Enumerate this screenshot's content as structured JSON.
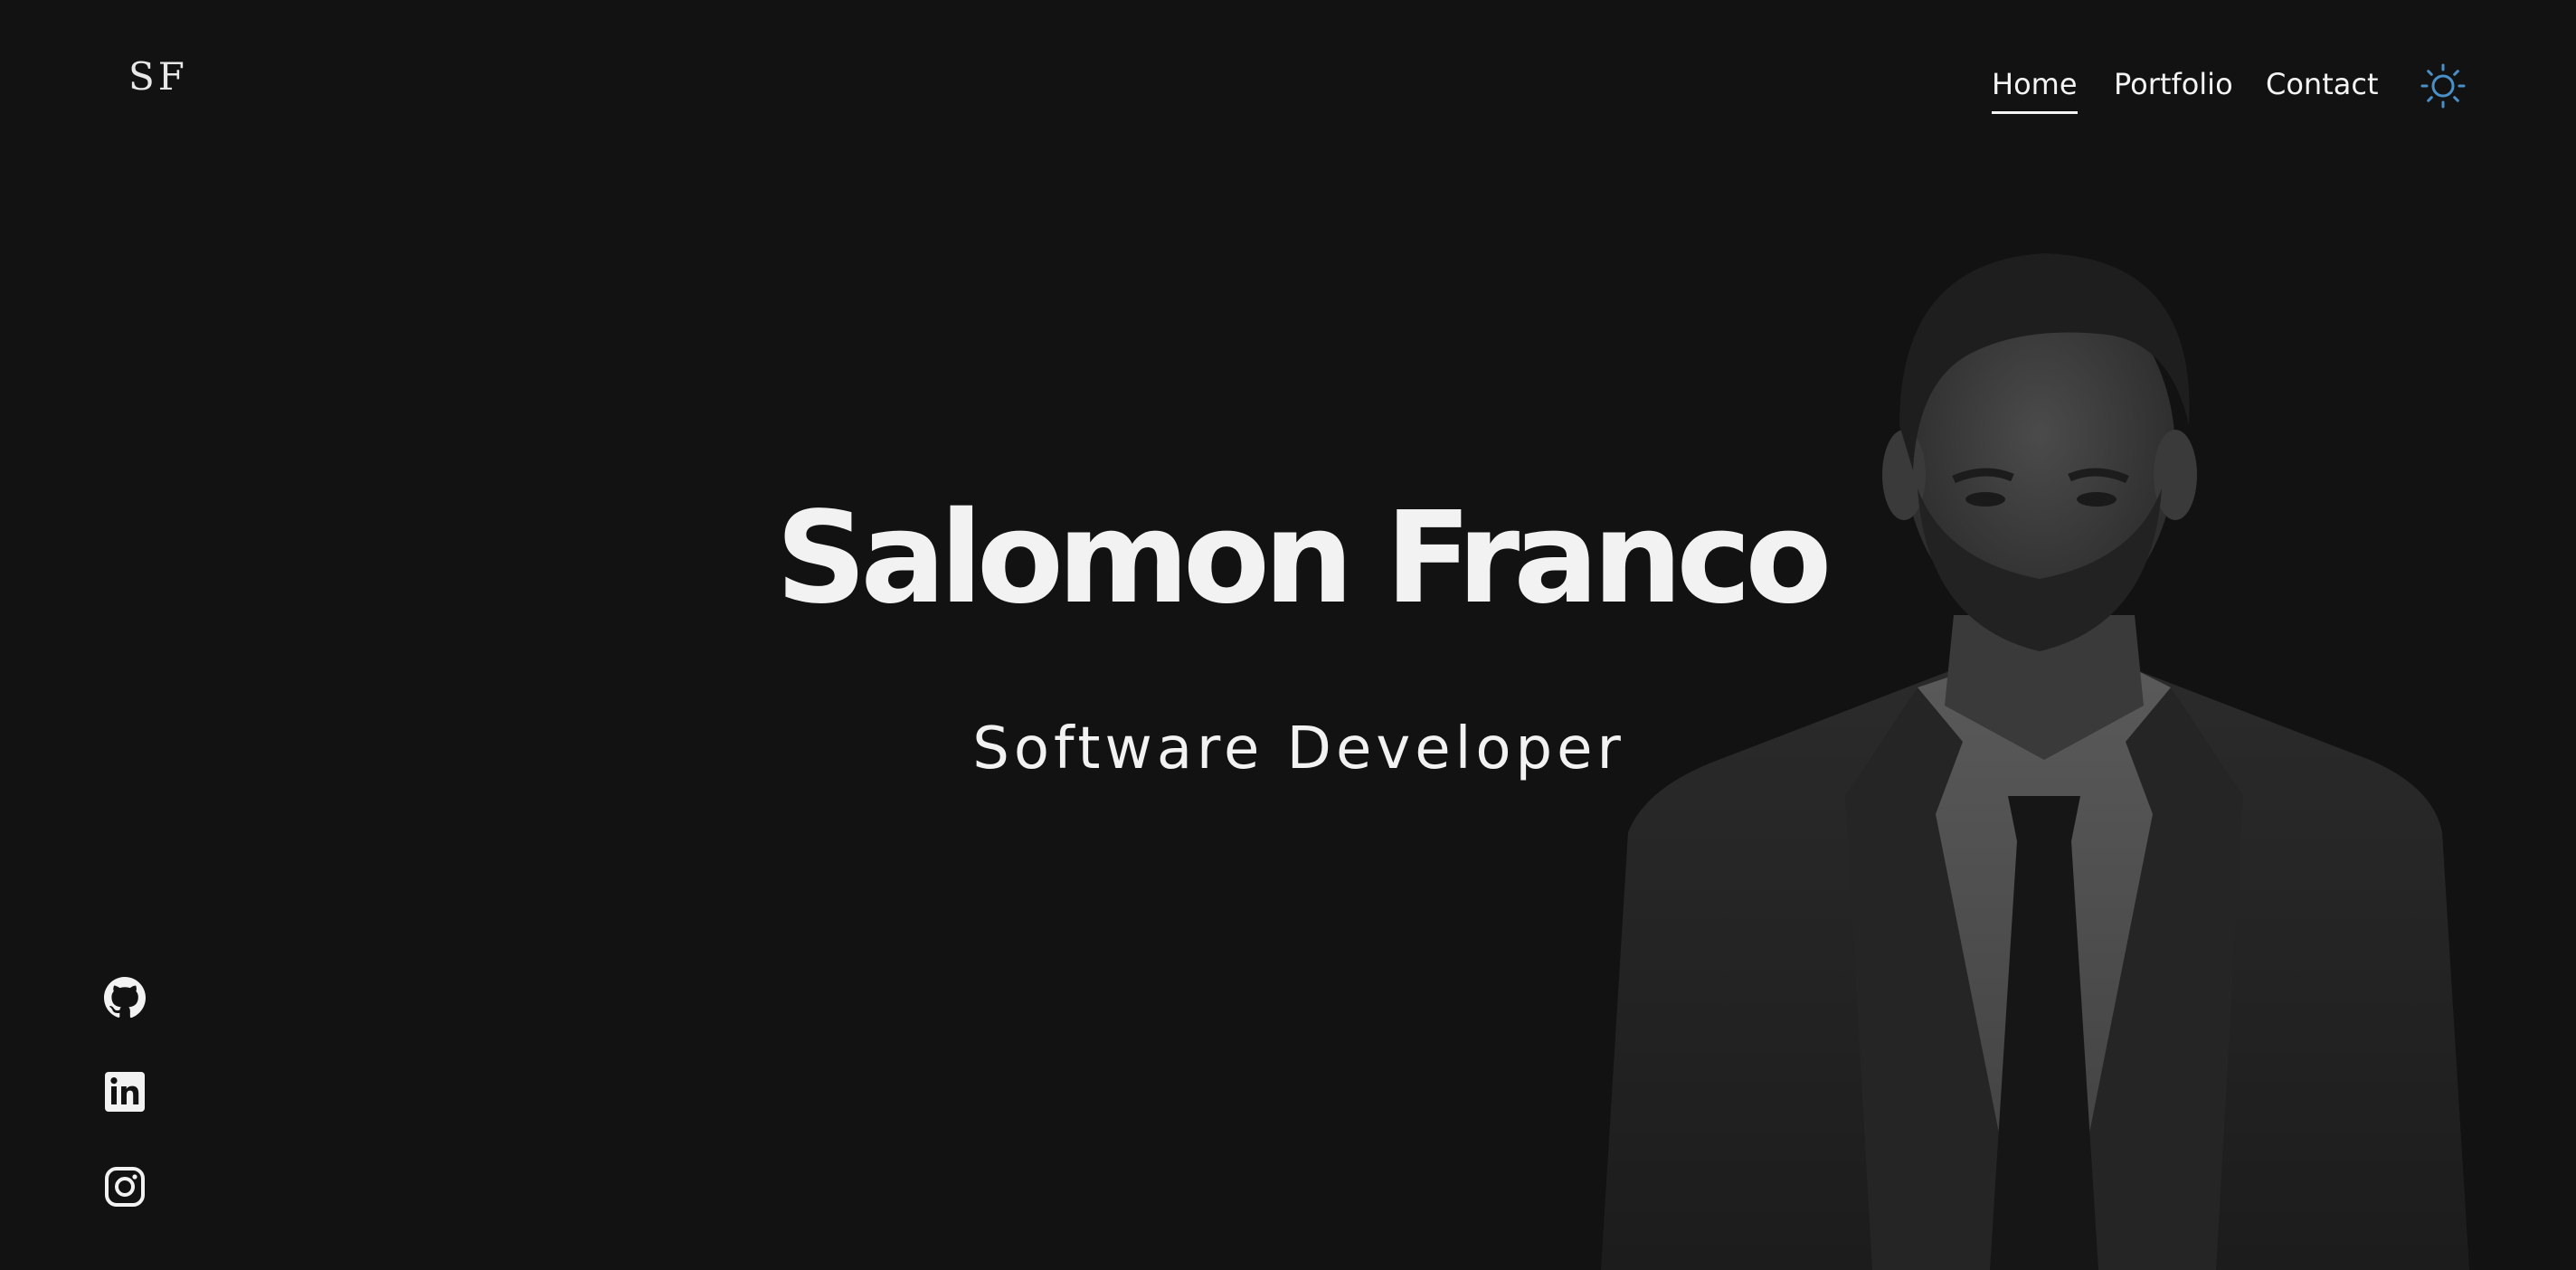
{
  "brand": {
    "logo_text": "SF"
  },
  "nav": {
    "items": [
      {
        "label": "Home",
        "active": true
      },
      {
        "label": "Portfolio",
        "active": false
      },
      {
        "label": "Contact",
        "active": false
      }
    ],
    "theme_toggle_icon": "sun-icon"
  },
  "hero": {
    "name": "Salomon Franco",
    "role": "Software Developer"
  },
  "social": [
    {
      "icon": "github-icon"
    },
    {
      "icon": "linkedin-icon"
    },
    {
      "icon": "instagram-icon"
    }
  ],
  "colors": {
    "background": "#121212",
    "text": "#f2f2f2",
    "accent": "#4a90c8"
  }
}
